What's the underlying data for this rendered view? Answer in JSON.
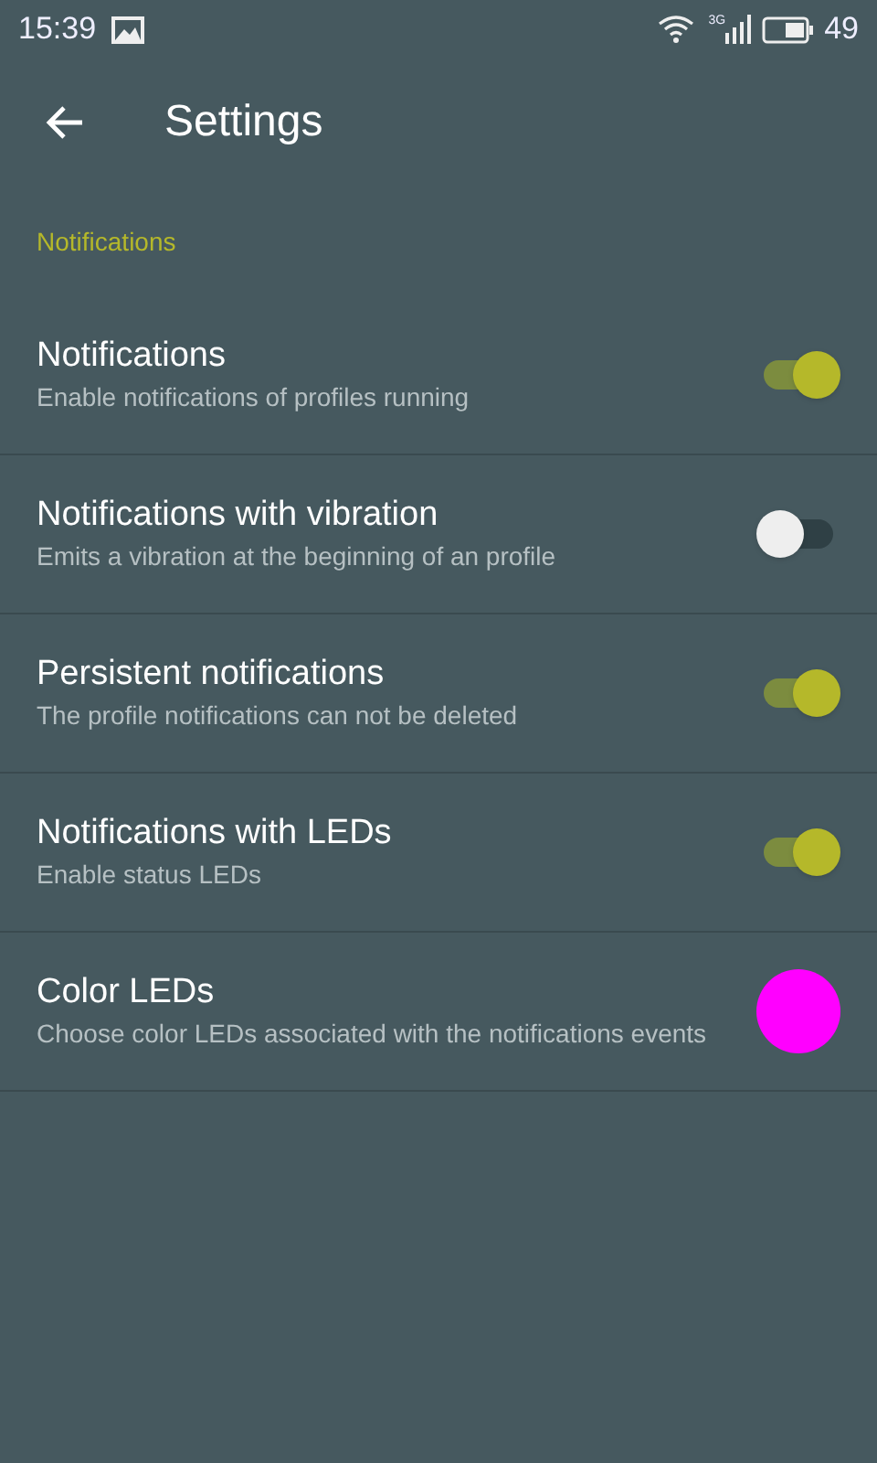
{
  "status_bar": {
    "time": "15:39",
    "network": "3G",
    "battery": "49"
  },
  "toolbar": {
    "title": "Settings"
  },
  "section": {
    "title": "Notifications"
  },
  "settings": [
    {
      "kind": "switch",
      "title": "Notifications",
      "summary": "Enable notifications of profiles running",
      "on": true
    },
    {
      "kind": "switch",
      "title": "Notifications with vibration",
      "summary": "Emits a vibration at the beginning of an profile",
      "on": false
    },
    {
      "kind": "switch",
      "title": "Persistent notifications",
      "summary": "The profile notifications can not be deleted",
      "on": true
    },
    {
      "kind": "switch",
      "title": "Notifications with LEDs",
      "summary": "Enable status LEDs",
      "on": true
    },
    {
      "kind": "color",
      "title": "Color LEDs",
      "summary": "Choose color LEDs associated with the notifications events",
      "color": "#ff00ff"
    }
  ]
}
